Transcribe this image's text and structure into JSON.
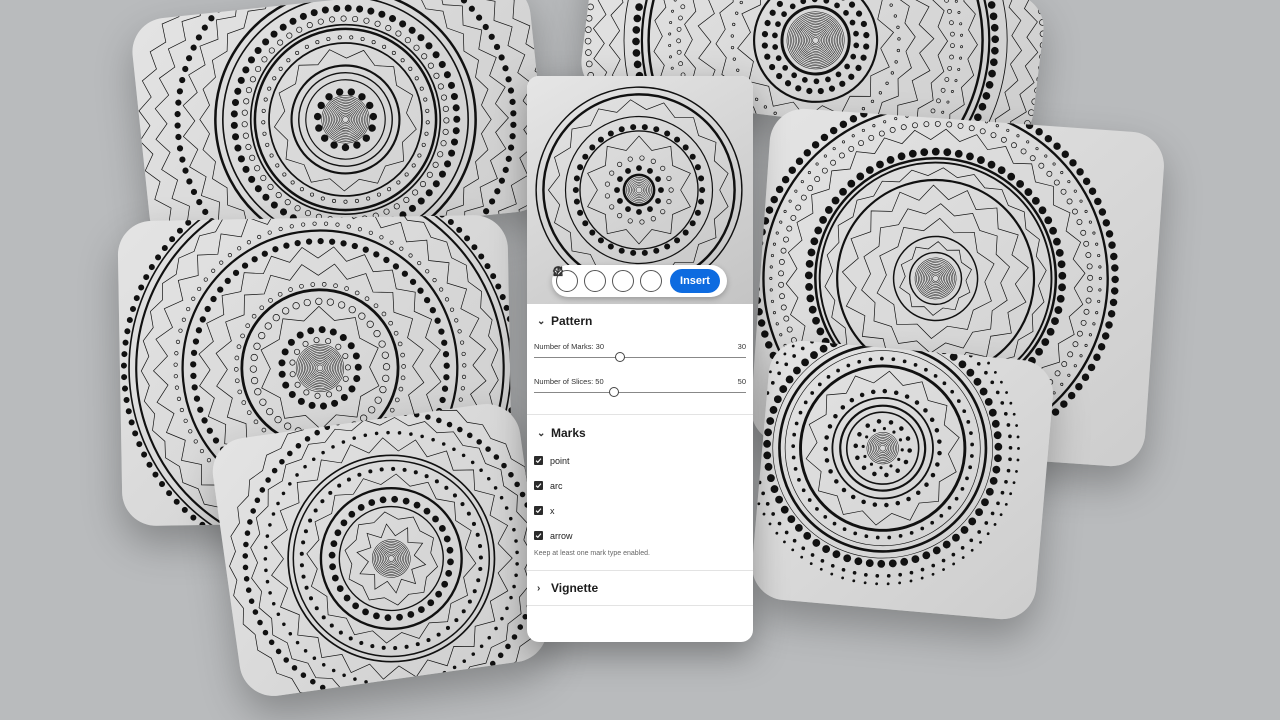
{
  "toolbar": {
    "icons": [
      "code-icon",
      "shuffle-icon",
      "reset-icon",
      "download-icon"
    ],
    "insert_label": "Insert",
    "accent": "#0d6be0"
  },
  "pattern": {
    "title": "Pattern",
    "marks_label": "Number of Marks: 30",
    "marks_value": "30",
    "marks_fraction": 0.4,
    "slices_label": "Number of Slices: 50",
    "slices_value": "50",
    "slices_fraction": 0.37
  },
  "marks": {
    "title": "Marks",
    "options": [
      {
        "label": "point",
        "checked": true
      },
      {
        "label": "arc",
        "checked": true
      },
      {
        "label": "x",
        "checked": true
      },
      {
        "label": "arrow",
        "checked": true
      }
    ],
    "hint": "Keep at least one mark type enabled."
  },
  "vignette": {
    "title": "Vignette"
  }
}
